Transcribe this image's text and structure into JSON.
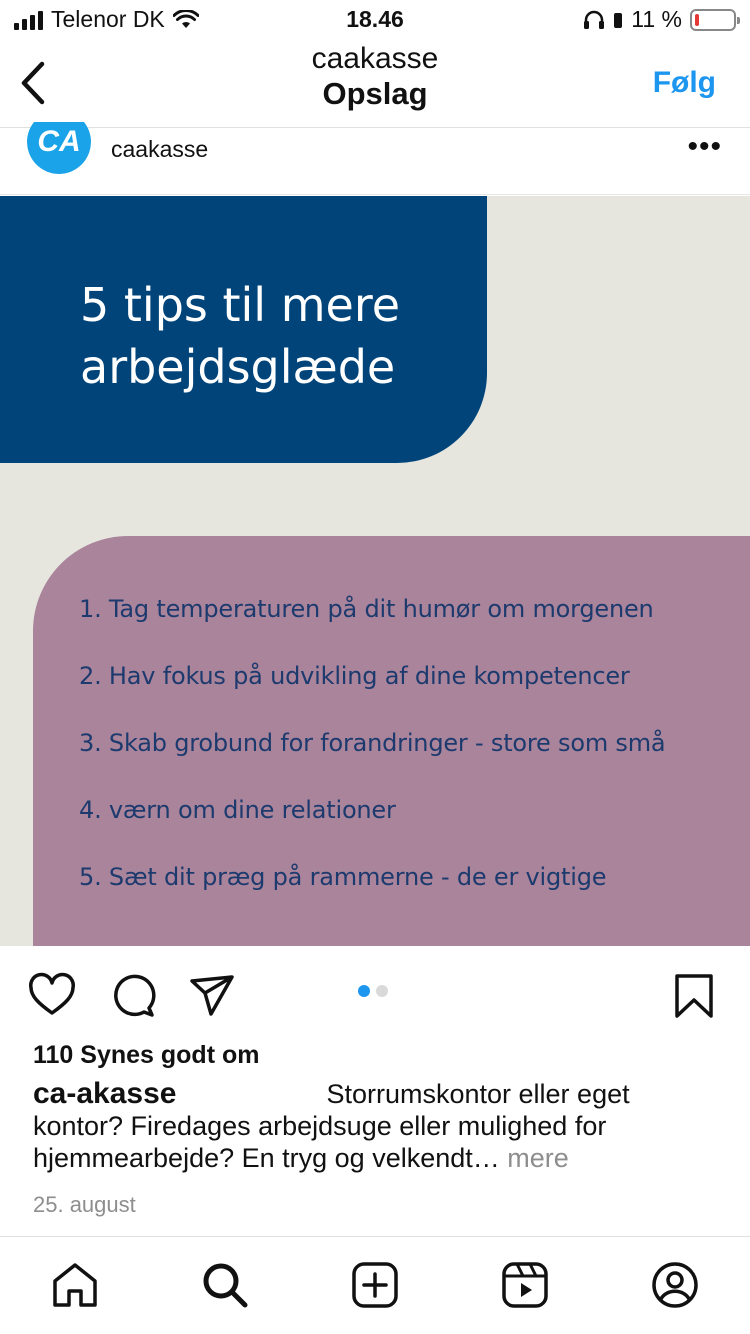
{
  "status_bar": {
    "carrier": "Telenor DK",
    "time": "18.46",
    "battery_text": "11 %",
    "battery_level": 0.11,
    "battery_color": "#e53935"
  },
  "header": {
    "back_icon": "chevron-left-icon",
    "username": "caakasse",
    "title": "Opslag",
    "follow_label": "Følg",
    "accent_color": "#1d96f0"
  },
  "post": {
    "avatar_text": "CA",
    "username": "caakasse",
    "more_icon": "more-horizontal-icon",
    "image": {
      "headline_line1": "5 tips til mere",
      "headline_line2": "arbejdsglæde",
      "tips": [
        "1. Tag temperaturen på dit humør om morgenen",
        "2. Hav fokus på udvikling af dine kompetencer",
        "3. Skab grobund for forandringer - store som små",
        "4. værn om dine relationer",
        "5. Sæt dit præg på rammerne - de er vigtige"
      ],
      "colors": {
        "blue": "#00447a",
        "purple": "#a9849b",
        "background": "#e6e6df",
        "tip_text": "#1d3a6e"
      }
    },
    "carousel": {
      "total": 2,
      "active_index": 0
    },
    "likes": "110 Synes godt om",
    "caption_user": "ca-akasse",
    "caption_text": "Storrumskontor eller eget kontor? Firedages arbejdsuge eller mulighed for hjemmearbejde? En tryg og velkendt…",
    "more_label": "mere",
    "date": "25. august"
  },
  "tabbar": {
    "items": [
      "home-icon",
      "search-icon",
      "new-post-icon",
      "reels-icon",
      "profile-icon"
    ]
  }
}
